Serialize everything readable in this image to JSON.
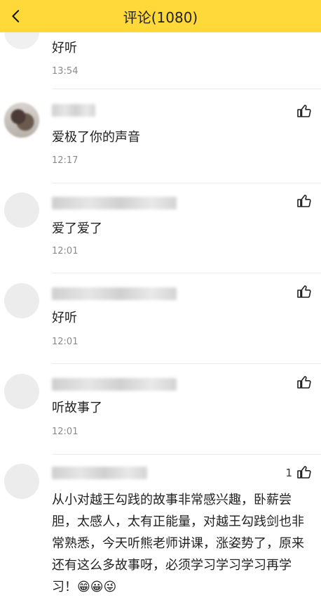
{
  "header": {
    "title": "评论(1080)"
  },
  "comments": [
    {
      "text": "好听",
      "time": "13:54"
    },
    {
      "text": "爱极了你的声音",
      "time": "12:17"
    },
    {
      "text": "爱了爱了",
      "time": "12:01"
    },
    {
      "text": "好听",
      "time": "12:01"
    },
    {
      "text": "听故事了",
      "time": "12:01"
    },
    {
      "text": "从小对越王勾践的故事非常感兴趣，卧薪尝胆，太感人，太有正能量，对越王勾践剑也非常熟悉，今天听熊老师讲课，涨姿势了，原来还有这么多故事呀，必须学习学习学习再学习！😁😀😜",
      "likes": "1"
    }
  ],
  "icons": {
    "back": "chevron-left-icon",
    "like": "thumbs-up-icon"
  },
  "colors": {
    "header_bg": "#FFD83A"
  }
}
